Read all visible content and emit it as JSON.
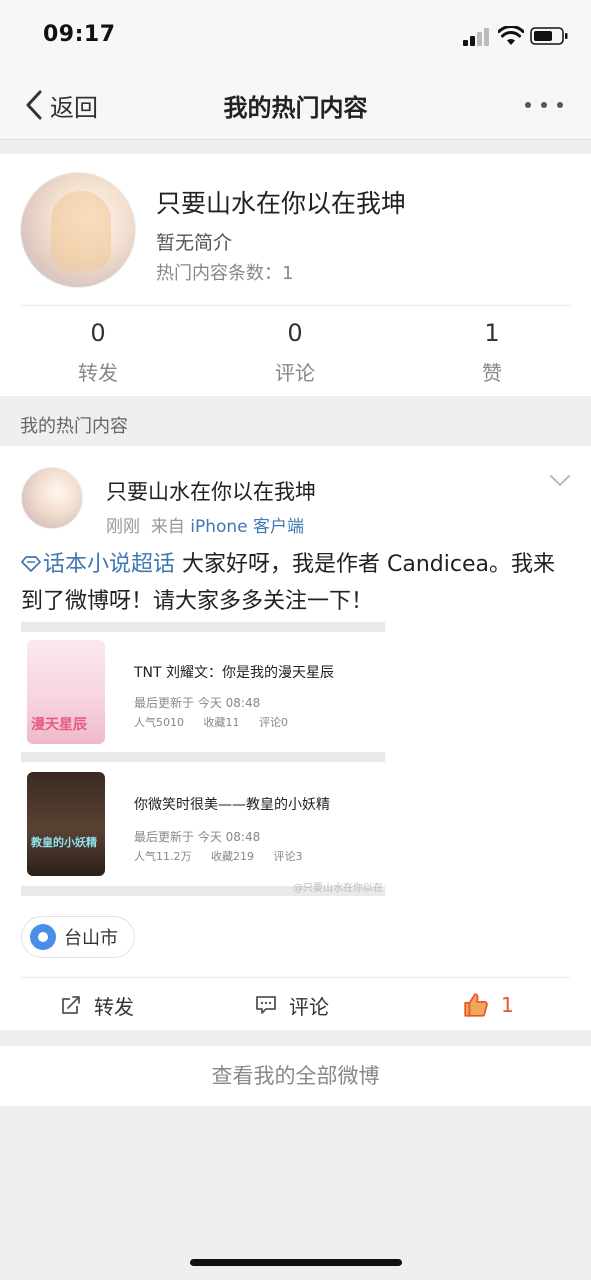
{
  "status_bar": {
    "time": "09:17"
  },
  "nav": {
    "back_label": "返回",
    "title": "我的热门内容"
  },
  "profile": {
    "name": "只要山水在你以在我坤",
    "intro": "暂无简介",
    "hot_count": "热门内容条数：1",
    "stats": [
      {
        "value": "0",
        "label": "转发"
      },
      {
        "value": "0",
        "label": "评论"
      },
      {
        "value": "1",
        "label": "赞"
      }
    ]
  },
  "section_label": "我的热门内容",
  "post": {
    "author": "只要山水在你以在我坤",
    "time": "刚刚",
    "from_prefix": "来自",
    "source": "iPhone 客户端",
    "topic": "话本小说超话",
    "text": " 大家好呀，我是作者 Candicea。我来到了微博呀！请大家多多关注一下！",
    "books": [
      {
        "cover_text": "漫天星辰",
        "title": "TNT 刘耀文：你是我的漫天星辰",
        "updated": "最后更新于 今天 08:48",
        "popularity": "人气5010",
        "favorites": "收藏11",
        "comments": "评论0"
      },
      {
        "cover_text": "教皇的小妖精",
        "title": "你微笑时很美——教皇的小妖精",
        "updated": "最后更新于 今天 08:48",
        "popularity": "人气11.2万",
        "favorites": "收藏219",
        "comments": "评论3"
      }
    ],
    "watermark": "@只要山水在你以在",
    "location": "台山市",
    "actions": {
      "repost": "转发",
      "comment": "评论",
      "like_count": "1"
    }
  },
  "view_all": "查看我的全部微博"
}
